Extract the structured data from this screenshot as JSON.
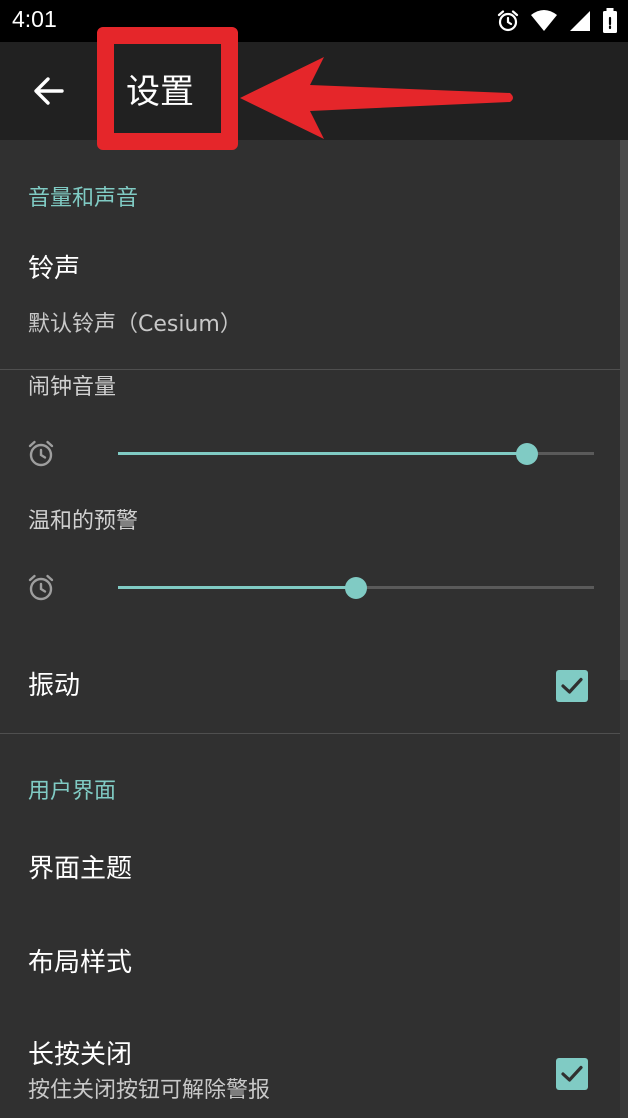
{
  "status_bar": {
    "time": "4:01"
  },
  "app_bar": {
    "title": "设置"
  },
  "sections": {
    "sound": {
      "header": "音量和声音"
    },
    "ui": {
      "header": "用户界面"
    }
  },
  "ringtone": {
    "title": "铃声",
    "summary": "默认铃声（Cesium）"
  },
  "alarm_volume": {
    "title": "闹钟音量",
    "level": 0.86
  },
  "gentle_alert": {
    "title": "温和的预警",
    "level": 0.5
  },
  "vibrate": {
    "title": "振动",
    "checked": true
  },
  "theme": {
    "title": "界面主题"
  },
  "layout": {
    "title": "布局样式"
  },
  "long_press": {
    "title": "长按关闭",
    "summary": "按住关闭按钮可解除警报",
    "checked": true
  },
  "colors": {
    "accent": "#80cbc4",
    "annotation": "#e5262a"
  }
}
